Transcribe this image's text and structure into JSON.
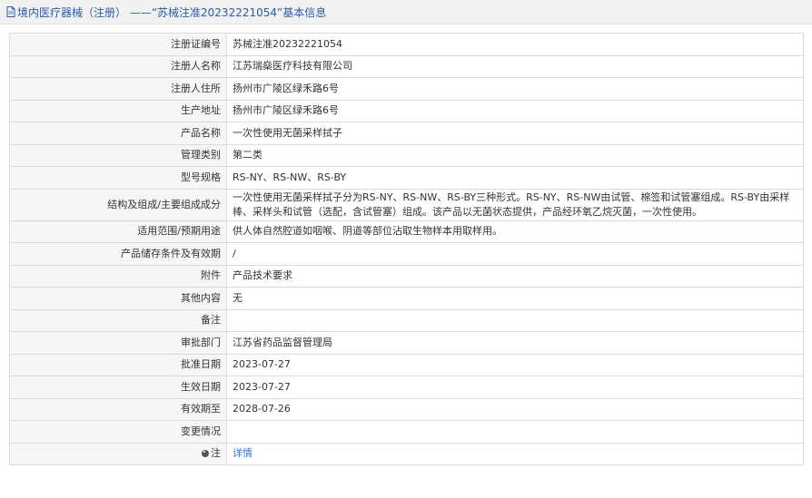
{
  "header": {
    "title": "境内医疗器械（注册） ——“苏械注准20232221054”基本信息"
  },
  "rows": [
    {
      "label": "注册证编号",
      "value": "苏械注准20232221054"
    },
    {
      "label": "注册人名称",
      "value": "江苏瑞燊医疗科技有限公司"
    },
    {
      "label": "注册人住所",
      "value": "扬州市广陵区绿禾路6号"
    },
    {
      "label": "生产地址",
      "value": "扬州市广陵区绿禾路6号"
    },
    {
      "label": "产品名称",
      "value": "一次性使用无菌采样拭子"
    },
    {
      "label": "管理类别",
      "value": "第二类"
    },
    {
      "label": "型号规格",
      "value": "RS-NY、RS-NW、RS-BY"
    },
    {
      "label": "结构及组成/主要组成成分",
      "value": "一次性使用无菌采样拭子分为RS-NY、RS-NW、RS-BY三种形式。RS-NY、RS-NW由试管、棉签和试管塞组成。RS-BY由采样棒、采样头和试管（选配，含试管塞）组成。该产品以无菌状态提供，产品经环氧乙烷灭菌，一次性使用。"
    },
    {
      "label": "适用范围/预期用途",
      "value": "供人体自然腔道如咽喉、阴道等部位沾取生物样本用取样用。"
    },
    {
      "label": "产品储存条件及有效期",
      "value": "/"
    },
    {
      "label": "附件",
      "value": "产品技术要求"
    },
    {
      "label": "其他内容",
      "value": "无"
    },
    {
      "label": "备注",
      "value": ""
    },
    {
      "label": "审批部门",
      "value": "江苏省药品监督管理局"
    },
    {
      "label": "批准日期",
      "value": "2023-07-27"
    },
    {
      "label": "生效日期",
      "value": "2023-07-27"
    },
    {
      "label": "有效期至",
      "value": "2028-07-26"
    },
    {
      "label": "变更情况",
      "value": ""
    },
    {
      "label": "注",
      "value": "详情"
    }
  ],
  "icons": {
    "header_icon": "document-icon",
    "note_icon": "note-icon"
  },
  "colors": {
    "link": "#2a76c6",
    "header_text": "#2a5caa",
    "label_bg": "#f6f6f6",
    "border": "#dcdcdc"
  }
}
